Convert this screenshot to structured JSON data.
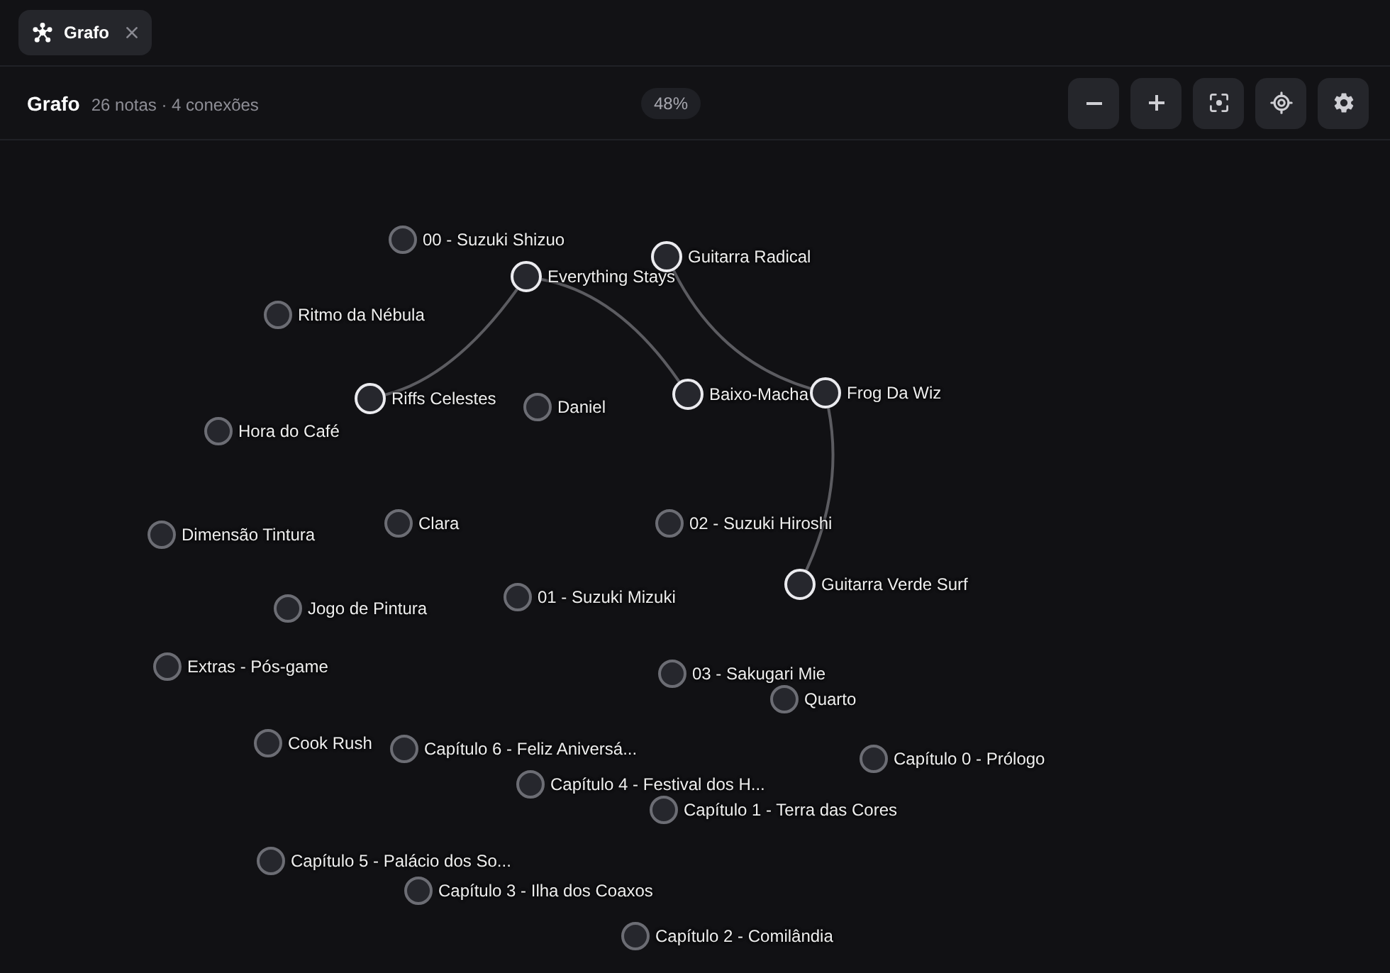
{
  "tabs": [
    {
      "label": "Grafo",
      "selected": true
    }
  ],
  "header": {
    "title": "Grafo",
    "stats": "26 notas · 4 conexões",
    "zoom": "48%"
  },
  "graph": {
    "nodes": [
      {
        "label": "00 - Suzuki Shizuo",
        "linked": false
      },
      {
        "label": "Everything Stays",
        "linked": true
      },
      {
        "label": "Guitarra Radical",
        "linked": true
      },
      {
        "label": "Ritmo da Nébula",
        "linked": false
      },
      {
        "label": "Riffs Celestes",
        "linked": true
      },
      {
        "label": "Daniel",
        "linked": false
      },
      {
        "label": "Baixo-Macha",
        "linked": true
      },
      {
        "label": "Frog Da Wiz",
        "linked": true
      },
      {
        "label": "Hora do Café",
        "linked": false
      },
      {
        "label": "Dimensão Tintura",
        "linked": false
      },
      {
        "label": "Clara",
        "linked": false
      },
      {
        "label": "02 - Suzuki Hiroshi",
        "linked": false
      },
      {
        "label": "Guitarra Verde Surf",
        "linked": true
      },
      {
        "label": "Jogo de Pintura",
        "linked": false
      },
      {
        "label": "01 - Suzuki Mizuki",
        "linked": false
      },
      {
        "label": "Extras - Pós-game",
        "linked": false
      },
      {
        "label": "03 - Sakugari Mie",
        "linked": false
      },
      {
        "label": "Quarto",
        "linked": false
      },
      {
        "label": "Cook Rush",
        "linked": false
      },
      {
        "label": "Capítulo 6 - Feliz Aniversá...",
        "linked": false
      },
      {
        "label": "Capítulo 0 - Prólogo",
        "linked": false
      },
      {
        "label": "Capítulo 4 - Festival dos H...",
        "linked": false
      },
      {
        "label": "Capítulo 1 - Terra das Cores",
        "linked": false
      },
      {
        "label": "Capítulo 5 - Palácio dos So...",
        "linked": false
      },
      {
        "label": "Capítulo 3 - Ilha dos Coaxos",
        "linked": false
      },
      {
        "label": "Capítulo 2 - Comilândia",
        "linked": false
      }
    ]
  }
}
